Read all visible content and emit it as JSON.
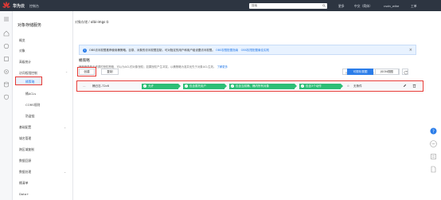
{
  "topbar": {
    "brand": "华为云",
    "console": "控制台",
    "search_placeholder": "搜索",
    "nav": [
      "更多",
      "中文（简体）",
      "csdn_wike",
      "工单"
    ]
  },
  "menu": {
    "title": "对象存储服务",
    "items": [
      {
        "label": "概览"
      },
      {
        "label": "对象"
      },
      {
        "label": "高级统计"
      },
      {
        "label": "访问权限控制"
      }
    ],
    "sub_items": [
      "桶策略",
      "桶ACLs",
      "CORS规则",
      "防盗链"
    ],
    "more_items": [
      "基础配置",
      "域名管理",
      "跨区域复制",
      "数据回源",
      "数据处理",
      "桶清单",
      "Data+"
    ]
  },
  "breadcrumb": {
    "root": "对象存储",
    "bucket": "olbi-imgs"
  },
  "notice": {
    "text": "OBS访问权限推荐使用桶策略。目录、对象的访问权限控制，可对指定的用户和用户组设置访问权限。",
    "link1": "OBS权限配置指南",
    "link2": "OBS权限配置最佳实践",
    "close": "×"
  },
  "section": {
    "title": "桶策略",
    "desc": "桶策略是基于资源的授权策略，可以为ACL的对象授权；如果授权产生冲突，以桶策略为准并优先于对象ACL生效。",
    "learn_more": "了解更多"
  },
  "toolbar": {
    "create": "创建",
    "copy": "复制",
    "filter_placeholder": "默认按照名称搜索、过滤",
    "visual_view": "可视化视图",
    "json_view": "JSON视图"
  },
  "rule": {
    "expand": "—",
    "name": "桶日志-72c6",
    "effect": "允许",
    "principal": "包含委托用户",
    "resource": "包含当前桶、桶内所有对象",
    "action": "包含3个动作",
    "condition": "无条件"
  },
  "colors": {
    "accent": "#2b7de9",
    "highlight": "#e53935",
    "chip": "#2dbe76",
    "topbar": "#2d3541"
  }
}
